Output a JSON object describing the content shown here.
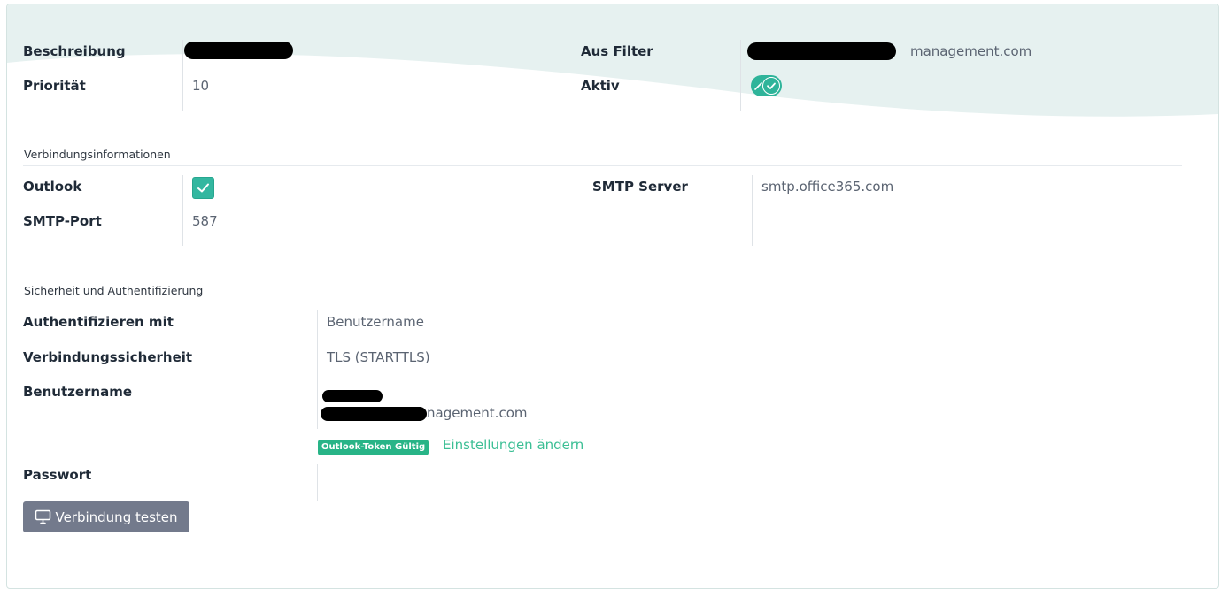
{
  "general": {
    "description_label": "Beschreibung",
    "description_value": "",
    "priority_label": "Priorität",
    "priority_value": "10",
    "from_filter_label": "Aus Filter",
    "from_filter_value": "management.com",
    "active_label": "Aktiv",
    "active_state": true
  },
  "connection": {
    "section_title": "Verbindungsinformationen",
    "outlook_label": "Outlook",
    "outlook_checked": true,
    "smtp_port_label": "SMTP-Port",
    "smtp_port_value": "587",
    "smtp_server_label": "SMTP Server",
    "smtp_server_value": "smtp.office365.com"
  },
  "security": {
    "section_title": "Sicherheit und Authentifizierung",
    "auth_label": "Authentifizieren mit",
    "auth_value": "Benutzername",
    "conn_security_label": "Verbindungssicherheit",
    "conn_security_value": "TLS (STARTTLS)",
    "username_label": "Benutzername",
    "username_value_line1": "",
    "username_value_line2": "nagement.com",
    "token_badge": "Outlook-Token Gültig",
    "change_settings_link": "Einstellungen ändern",
    "password_label": "Passwort"
  },
  "actions": {
    "test_connection_label": "Verbindung testen"
  },
  "colors": {
    "accent": "#2fb49a",
    "link": "#3cbf95",
    "badge": "#28b487",
    "button": "#737a8c",
    "wave": "#e6f1f0"
  }
}
